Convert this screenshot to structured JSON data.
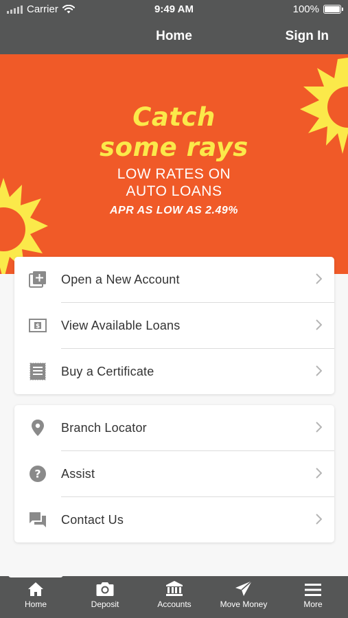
{
  "status_bar": {
    "carrier": "Carrier",
    "time": "9:49 AM",
    "battery": "100%"
  },
  "nav": {
    "title": "Home",
    "sign_in": "Sign In"
  },
  "banner": {
    "headline_line1": "Catch",
    "headline_line2": "some rays",
    "subhead_line1": "LOW RATES ON",
    "subhead_line2": "AUTO LOANS",
    "apr": "APR AS LOW AS 2.49%",
    "colors": {
      "background": "#f05a28",
      "sun_yellow": "#fbe94a"
    }
  },
  "card1": {
    "items": [
      {
        "label": "Open a New Account",
        "icon": "add-account-icon"
      },
      {
        "label": "View Available Loans",
        "icon": "money-bill-icon"
      },
      {
        "label": "Buy a Certificate",
        "icon": "certificate-icon"
      }
    ]
  },
  "card2": {
    "items": [
      {
        "label": "Branch Locator",
        "icon": "map-pin-icon"
      },
      {
        "label": "Assist",
        "icon": "help-icon"
      },
      {
        "label": "Contact Us",
        "icon": "chat-icon"
      }
    ]
  },
  "tab_bar": {
    "tabs": [
      {
        "label": "Home",
        "icon": "home-icon"
      },
      {
        "label": "Deposit",
        "icon": "camera-icon"
      },
      {
        "label": "Accounts",
        "icon": "bank-icon"
      },
      {
        "label": "Move Money",
        "icon": "send-icon"
      },
      {
        "label": "More",
        "icon": "menu-icon"
      }
    ]
  }
}
